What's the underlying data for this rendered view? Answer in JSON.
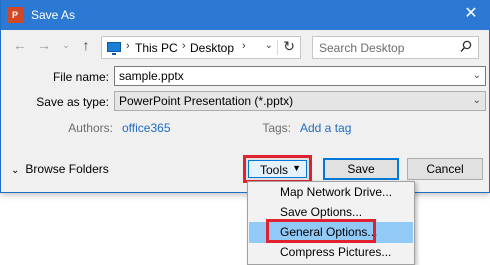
{
  "window": {
    "title": "Save As",
    "app_icon_text": "P"
  },
  "nav": {
    "breadcrumb": [
      "This PC",
      "Desktop"
    ],
    "search_placeholder": "Search Desktop"
  },
  "form": {
    "file_name_label": "File name:",
    "file_name_value": "sample.pptx",
    "save_type_label": "Save as type:",
    "save_type_value": "PowerPoint Presentation (*.pptx)",
    "authors_label": "Authors:",
    "authors_value": "office365",
    "tags_label": "Tags:",
    "tags_value": "Add a tag"
  },
  "footer": {
    "browse_folders": "Browse Folders",
    "tools_label": "Tools",
    "save_label": "Save",
    "cancel_label": "Cancel"
  },
  "tools_menu": {
    "items": [
      "Map Network Drive...",
      "Save Options...",
      "General Options...",
      "Compress Pictures..."
    ],
    "highlighted_index": 2
  },
  "colors": {
    "titlebar": "#2b79d3",
    "highlight_box": "#e0222f",
    "menu_highlight": "#91c9f7",
    "link": "#1e6cc1"
  }
}
